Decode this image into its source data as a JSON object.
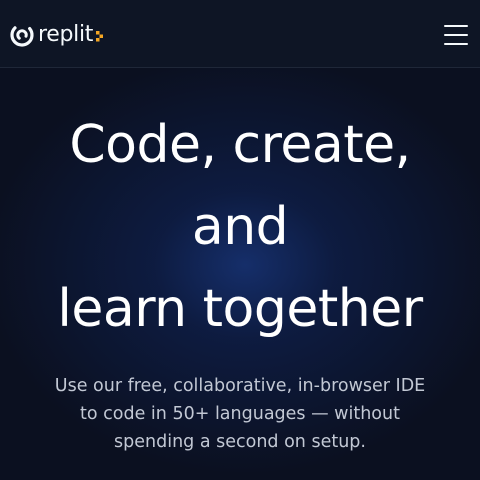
{
  "header": {
    "logo_text": "replit",
    "logo_icon": "replit-spiral-icon",
    "menu_icon": "hamburger-menu-icon"
  },
  "hero": {
    "title_lines": [
      "Code, create,",
      "and",
      "learn together"
    ],
    "subtitle_lines": [
      "Use our free, collaborative, in-browser IDE",
      "to code in 50+ languages — without",
      "spending a second on setup."
    ]
  },
  "colors": {
    "background": "#0b1020",
    "navbar": "#0e1525",
    "accent": "#f5a623",
    "text_primary": "#ffffff",
    "text_secondary": "#c2c8d4"
  }
}
